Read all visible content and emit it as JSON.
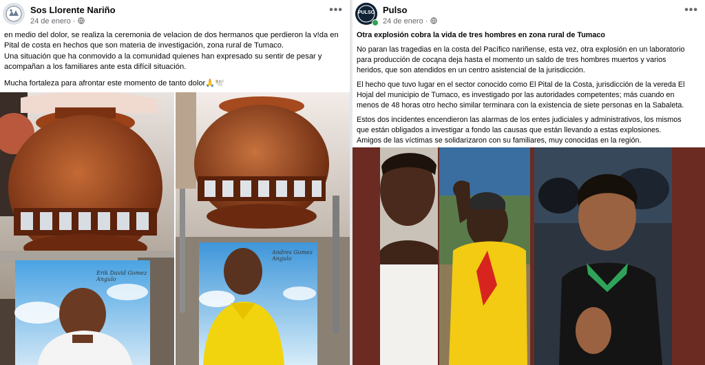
{
  "left_post": {
    "page_name": "Sos Llorente Nariño",
    "date": "24 de enero",
    "audience_icon": "globe-icon",
    "menu_icon": "more-icon",
    "text_lines": [
      "en medio del dolor, se realiza la ceremonia de velacion  de dos hermanos que perdieron la v!da en",
      "Pital de costa en hechos que son materia de investigación, zona rural de Tumaco.",
      "Una situación que ha conmovido a la comunidad quienes han expresado su sentir de pesar y",
      "acompañan a los familiares ante esta difícil situación."
    ],
    "closing": "Mucha fortaleza  para afrontar este momento de tanto dolor🙏🕊️",
    "photo_cards": [
      "Erik David Gomez Angulo",
      "Andres Gomez Angulo"
    ]
  },
  "right_post": {
    "page_name": "Pulso",
    "avatar_text": "PULSO",
    "date": "24 de enero",
    "audience_icon": "globe-icon",
    "menu_icon": "more-icon",
    "title": "Otra explosión cobra la vida de tres hombres en zona rural de Tumaco",
    "p1_lines": [
      "No paran las tragedias en la costa del Pacífico nariñense, esta vez, otra explosión en un laboratorio",
      "para producción de cocąna deja hasta el momento un saldo de tres hombres muertos y varios",
      "heridos, que son atendidos en un centro asistencial de la jurisdicción."
    ],
    "p2_lines": [
      "El hecho que tuvo lugar en el sector conocido como El Pital de la Costa, jurisdicción de la vereda El",
      "Hojal del municipio de Tumaco, es investigado por las autoridades competentes; más cuando en",
      "menos de 48 horas otro hecho similar terminara con la existencia de siete personas en la Sabaleta."
    ],
    "p3_lines": [
      "Estos dos incidentes encendieron las alarmas de los entes judiciales y administrativos, los mismos",
      "que están obligados a investigar a fondo las causas que están llevando a estas explosiones.",
      "Amigos de las víctimas se solidarizaron con su familiares, muy conocidas en la región."
    ]
  },
  "colors": {
    "text": "#050505",
    "secondary": "#65676b",
    "divider": "#e4e6eb",
    "pulso_green": "#31a24c",
    "urn": "#8a3d1c"
  }
}
